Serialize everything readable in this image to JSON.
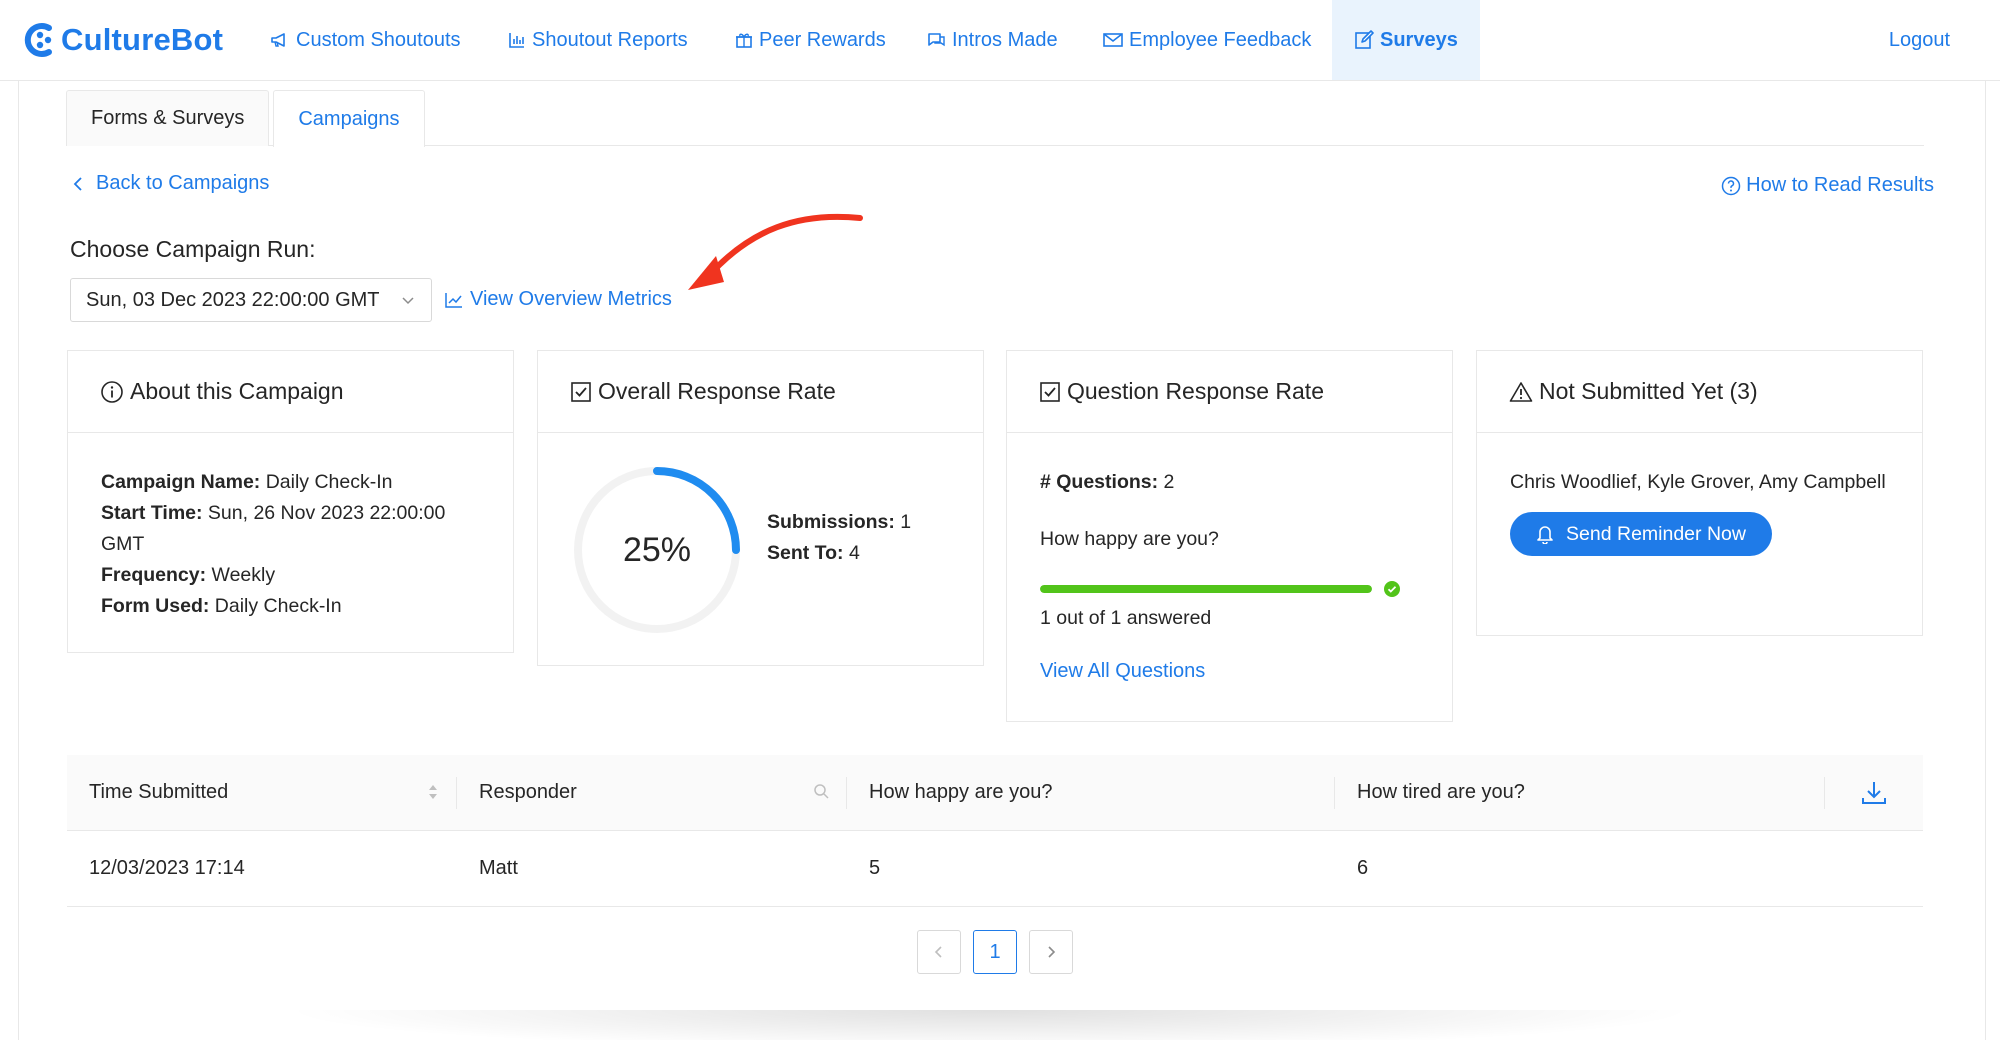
{
  "brand": {
    "name": "CultureBot",
    "color": "#1f7be8"
  },
  "nav": {
    "items": [
      {
        "label": "Custom Shoutouts",
        "icon": "megaphone-icon"
      },
      {
        "label": "Shoutout Reports",
        "icon": "bar-chart-icon"
      },
      {
        "label": "Peer Rewards",
        "icon": "gift-icon"
      },
      {
        "label": "Intros Made",
        "icon": "chat-icon"
      },
      {
        "label": "Employee Feedback",
        "icon": "mail-icon"
      },
      {
        "label": "Surveys",
        "icon": "edit-icon",
        "active": true
      }
    ],
    "logout": "Logout"
  },
  "tabs": [
    {
      "label": "Forms & Surveys",
      "active": false
    },
    {
      "label": "Campaigns",
      "active": true
    }
  ],
  "back_link": "Back to Campaigns",
  "help_link": "How to Read Results",
  "choose_run": {
    "label": "Choose Campaign Run:",
    "selected": "Sun, 03 Dec 2023 22:00:00 GMT",
    "overview_link": "View Overview Metrics"
  },
  "about": {
    "title": "About this Campaign",
    "campaign_name_label": "Campaign Name:",
    "campaign_name": "Daily Check-In",
    "start_time_label": "Start Time:",
    "start_time": "Sun, 26 Nov 2023 22:00:00 GMT",
    "frequency_label": "Frequency:",
    "frequency": "Weekly",
    "form_used_label": "Form Used:",
    "form_used": "Daily Check-In"
  },
  "overall": {
    "title": "Overall Response Rate",
    "percent_label": "25%",
    "percent_value": 0.25,
    "submissions_label": "Submissions:",
    "submissions": "1",
    "sent_to_label": "Sent To:",
    "sent_to": "4"
  },
  "question_rate": {
    "title": "Question Response Rate",
    "count_label": "# Questions:",
    "count": "2",
    "question": "How happy are you?",
    "progress": 1.0,
    "answered_text": "1 out of 1 answered",
    "view_all": "View All Questions"
  },
  "not_submitted": {
    "title": "Not Submitted Yet (3)",
    "names": "Chris Woodlief, Kyle Grover, Amy Campbell",
    "button": "Send Reminder Now"
  },
  "table": {
    "headers": [
      "Time Submitted",
      "Responder",
      "How happy are you?",
      "How tired are you?"
    ],
    "rows": [
      {
        "time": "12/03/2023 17:14",
        "responder": "Matt",
        "happy": "5",
        "tired": "6"
      }
    ]
  },
  "pagination": {
    "current": "1"
  },
  "colors": {
    "accent": "#1f7be8",
    "success": "#52c41a",
    "arrow": "#f0341f"
  }
}
